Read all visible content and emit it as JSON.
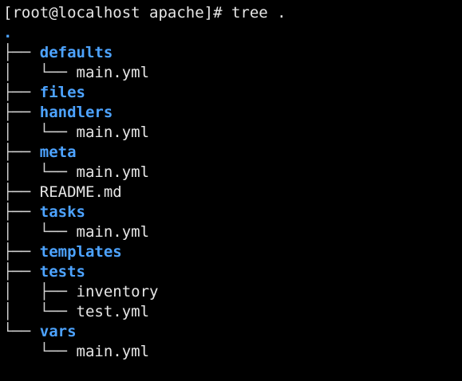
{
  "terminal": {
    "prompt": "[root@localhost apache]# ",
    "command": "tree .",
    "colors": {
      "background": "#000000",
      "text": "#e6e6e6",
      "directory": "#4da3ff"
    },
    "tree": [
      {
        "prefix": "",
        "name": ".",
        "type": "dir"
      },
      {
        "prefix": "├── ",
        "name": "defaults",
        "type": "dir"
      },
      {
        "prefix": "│   └── ",
        "name": "main.yml",
        "type": "file"
      },
      {
        "prefix": "├── ",
        "name": "files",
        "type": "dir"
      },
      {
        "prefix": "├── ",
        "name": "handlers",
        "type": "dir"
      },
      {
        "prefix": "│   └── ",
        "name": "main.yml",
        "type": "file"
      },
      {
        "prefix": "├── ",
        "name": "meta",
        "type": "dir"
      },
      {
        "prefix": "│   └── ",
        "name": "main.yml",
        "type": "file"
      },
      {
        "prefix": "├── ",
        "name": "README.md",
        "type": "file"
      },
      {
        "prefix": "├── ",
        "name": "tasks",
        "type": "dir"
      },
      {
        "prefix": "│   └── ",
        "name": "main.yml",
        "type": "file"
      },
      {
        "prefix": "├── ",
        "name": "templates",
        "type": "dir"
      },
      {
        "prefix": "├── ",
        "name": "tests",
        "type": "dir"
      },
      {
        "prefix": "│   ├── ",
        "name": "inventory",
        "type": "file"
      },
      {
        "prefix": "│   └── ",
        "name": "test.yml",
        "type": "file"
      },
      {
        "prefix": "└── ",
        "name": "vars",
        "type": "dir"
      },
      {
        "prefix": "    └── ",
        "name": "main.yml",
        "type": "file"
      }
    ]
  }
}
